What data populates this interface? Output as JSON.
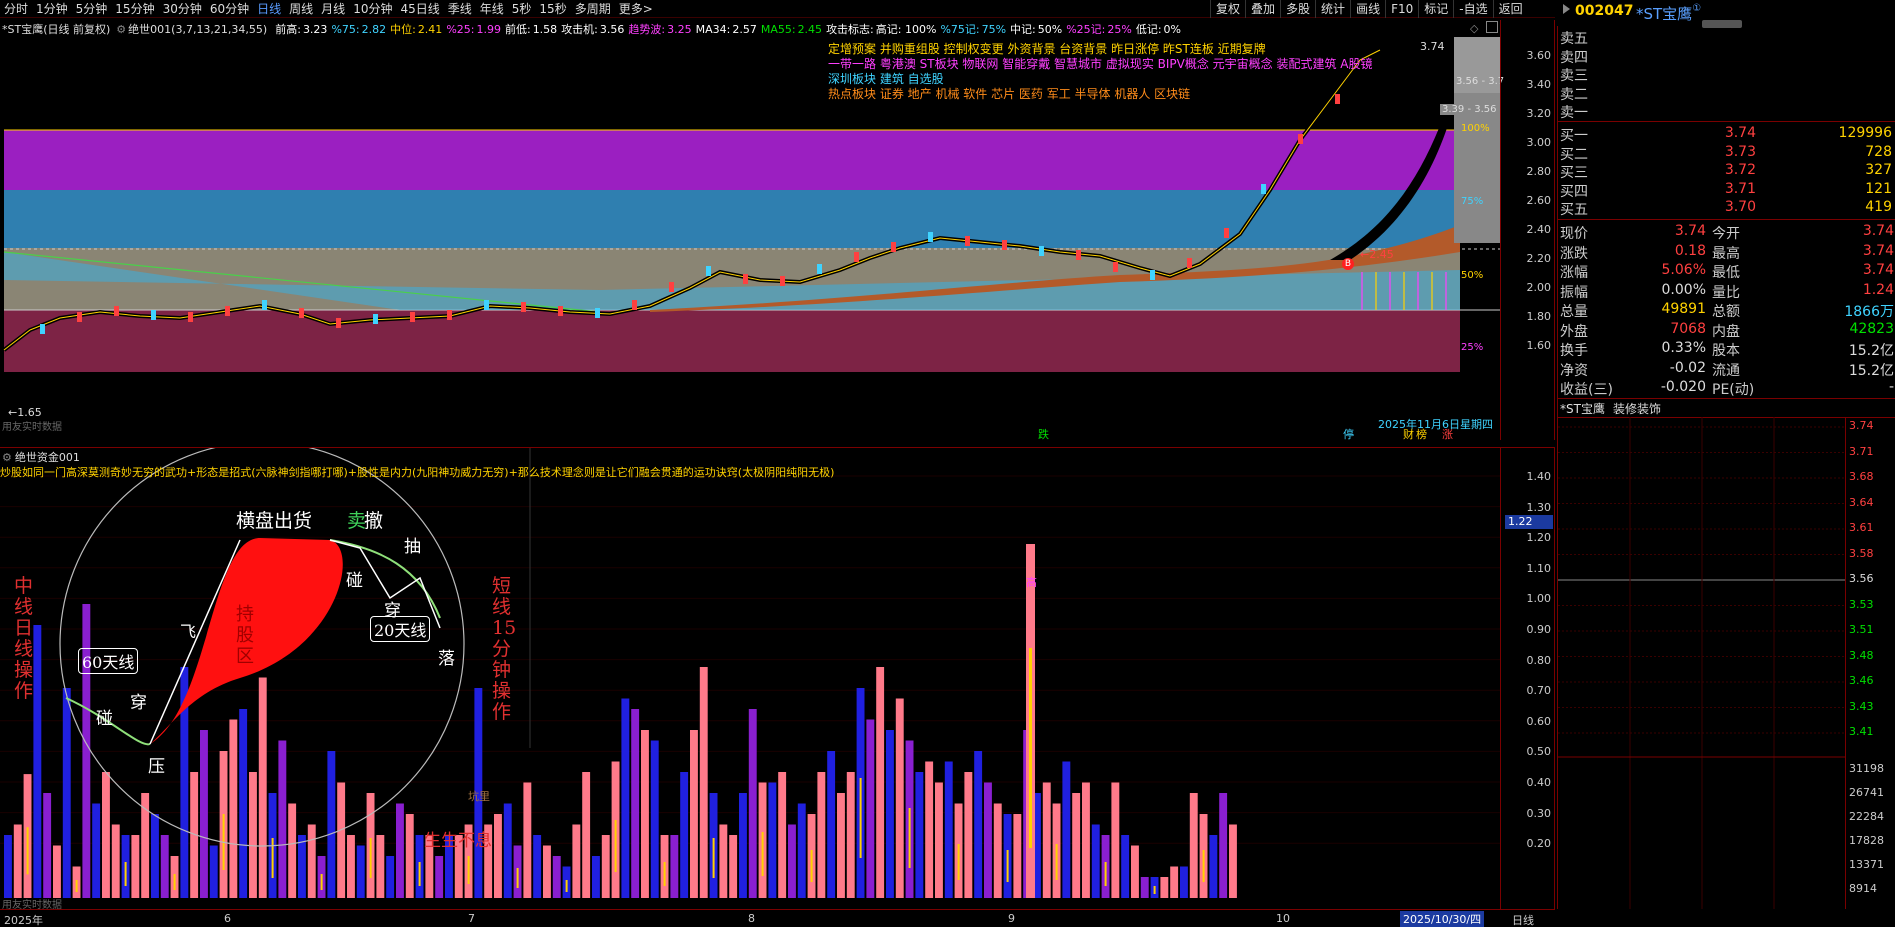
{
  "toolbar": {
    "periods": [
      "分时",
      "1分钟",
      "5分钟",
      "15分钟",
      "30分钟",
      "60分钟",
      "日线",
      "周线",
      "月线",
      "10分钟",
      "45日线",
      "季线",
      "年线",
      "5秒",
      "15秒",
      "多周期",
      "更多>"
    ],
    "active_period": "日线",
    "right_buttons": [
      "复权",
      "叠加",
      "多股",
      "统计",
      "画线",
      "F10",
      "标记",
      "-自选",
      "返回"
    ]
  },
  "stock": {
    "code": "002047",
    "name": "*ST宝鹰",
    "badge": "①"
  },
  "main_chart": {
    "title": "*ST宝鹰(日线 前复权)",
    "indicator_name": "绝世001",
    "indicator_params": "(3,7,13,21,34,55)",
    "readouts": [
      {
        "label": "前高:",
        "value": "3.23",
        "color": "#ffffff"
      },
      {
        "label": "%75:",
        "value": "2.82",
        "color": "#3fd3ff"
      },
      {
        "label": "中位:",
        "value": "2.41",
        "color": "#ffd200"
      },
      {
        "label": "%25:",
        "value": "1.99",
        "color": "#ff40ff"
      },
      {
        "label": "前低:",
        "value": "1.58",
        "color": "#ffffff"
      },
      {
        "label": "攻击机:",
        "value": "3.56",
        "color": "#ffffff"
      },
      {
        "label": "趋势波:",
        "value": "3.25",
        "color": "#ff40ff"
      },
      {
        "label": "MA34:",
        "value": "2.57",
        "color": "#ffffff"
      },
      {
        "label": "MA55:",
        "value": "2.45",
        "color": "#00e000"
      },
      {
        "label": "攻击标志:",
        "value": "高记: 100%",
        "color": "#ffffff"
      },
      {
        "label": "%75记:",
        "value": "75%",
        "color": "#3fd3ff"
      },
      {
        "label": "中记:",
        "value": "50%",
        "color": "#ffffff"
      },
      {
        "label": "%25记:",
        "value": "25%",
        "color": "#ff40ff"
      },
      {
        "label": "低记:",
        "value": "0%",
        "color": "#ffffff"
      }
    ],
    "info_lines": [
      {
        "label": "定增预案 并购重组股 控制权变更 外资背景 台资背景 昨日涨停 昨ST连板 近期复牌",
        "color": "#ffd200"
      },
      {
        "label": "一带一路 粤港澳 ST板块 物联网 智能穿戴 智慧城市 虚拟现实 BIPV概念 元宇宙概念 装配式建筑 A股镜",
        "color": "#ff40ff"
      },
      {
        "label": "深圳板块  建筑        自选股",
        "color": "#3fd3ff"
      },
      {
        "label": "热点板块  证券 地产 机械 软件 芯片 医药 军工 半导体 机器人 区块链",
        "color": "#ff8c1a"
      }
    ],
    "y_ticks": [
      "3.60",
      "3.40",
      "3.20",
      "3.00",
      "2.80",
      "2.60",
      "2.40",
      "2.20",
      "2.00",
      "1.80",
      "1.60"
    ],
    "zone_labels": [
      "100%",
      "75%",
      "50%",
      "25%"
    ],
    "low_label": "1.65",
    "last_price_tag": "3.74",
    "price_tag_2": "3.56 - 3.7",
    "price_tag_3": "3.39 - 3.56",
    "signal_b": "B",
    "signal_price": "2.45",
    "date_label": "2025年11月6日星期四",
    "bottom_marks": [
      {
        "text": "跌",
        "color": "#00e000"
      },
      {
        "text": "停",
        "color": "#3fd3ff"
      },
      {
        "text": "财",
        "color": "#ffd200"
      },
      {
        "text": "榜",
        "color": "#ffd200"
      },
      {
        "text": "涨",
        "color": "#ff4040"
      }
    ],
    "source_tag": "用友实时数据"
  },
  "indicator_chart": {
    "title": "绝世资金001",
    "description": "炒股如同一门高深莫测奇妙无穷的武功+形态是招式(六脉神剑指哪打哪)+股性是内力(九阳神功威力无穷)+那么技术理念则是让它们融会贯通的运功诀窍(太极阴阳纯阳无极)",
    "y_ticks": [
      "1.40",
      "1.30",
      "1.20",
      "1.10",
      "1.00",
      "0.90",
      "0.80",
      "0.70",
      "0.60",
      "0.50",
      "0.40",
      "0.30",
      "0.20"
    ],
    "current_value": "1.22",
    "peak_mark": "高",
    "diagram": {
      "top": "横盘出货",
      "sell": "卖",
      "cut": "撤",
      "pull": "抽",
      "touch": "碰",
      "cross": "穿",
      "twenty": "20天线",
      "fall": "落",
      "fly": "飞",
      "hold": "持股区",
      "sixty": "60天线",
      "touch2": "碰",
      "cross2": "穿",
      "press": "压",
      "left_vertical": "中线日线操作",
      "right_vertical": "短线15分钟操作",
      "pit": "坑里",
      "life": "生生不息"
    },
    "source_tag": "用友实时数据"
  },
  "x_axis": {
    "labels": [
      "2025年",
      "6",
      "7",
      "8",
      "9",
      "10"
    ],
    "current_date": "2025/10/30/四",
    "period": "日线"
  },
  "order_book": {
    "asks": [
      {
        "label": "卖五",
        "price": "",
        "vol": ""
      },
      {
        "label": "卖四",
        "price": "",
        "vol": ""
      },
      {
        "label": "卖三",
        "price": "",
        "vol": ""
      },
      {
        "label": "卖二",
        "price": "",
        "vol": ""
      },
      {
        "label": "卖一",
        "price": "",
        "vol": ""
      }
    ],
    "bids": [
      {
        "label": "买一",
        "price": "3.74",
        "vol": "129996"
      },
      {
        "label": "买二",
        "price": "3.73",
        "vol": "728"
      },
      {
        "label": "买三",
        "price": "3.72",
        "vol": "327"
      },
      {
        "label": "买四",
        "price": "3.71",
        "vol": "121"
      },
      {
        "label": "买五",
        "price": "3.70",
        "vol": "419"
      }
    ]
  },
  "quote": [
    {
      "l1": "现价",
      "v1": "3.74",
      "c1": "red",
      "l2": "今开",
      "v2": "3.74",
      "c2": "red"
    },
    {
      "l1": "涨跌",
      "v1": "0.18",
      "c1": "red",
      "l2": "最高",
      "v2": "3.74",
      "c2": "red"
    },
    {
      "l1": "涨幅",
      "v1": "5.06%",
      "c1": "red",
      "l2": "最低",
      "v2": "3.74",
      "c2": "red"
    },
    {
      "l1": "振幅",
      "v1": "0.00%",
      "c1": "white",
      "l2": "量比",
      "v2": "1.24",
      "c2": "red"
    },
    {
      "l1": "总量",
      "v1": "49891",
      "c1": "yellow",
      "l2": "总额",
      "v2": "1866万",
      "c2": "cyan"
    },
    {
      "l1": "外盘",
      "v1": "7068",
      "c1": "red",
      "l2": "内盘",
      "v2": "42823",
      "c2": "green"
    },
    {
      "l1": "换手",
      "v1": "0.33%",
      "c1": "white",
      "l2": "股本",
      "v2": "15.2亿",
      "c2": "white"
    },
    {
      "l1": "净资",
      "v1": "-0.02",
      "c1": "white",
      "l2": "流通",
      "v2": "15.2亿",
      "c2": "white"
    },
    {
      "l1": "收益(三)",
      "v1": "-0.020",
      "c1": "white",
      "l2": "PE(动)",
      "v2": "-",
      "c2": "white"
    }
  ],
  "mini_chart": {
    "title": "*ST宝鹰",
    "sector": "装修装饰",
    "price_ticks": [
      "3.74",
      "3.71",
      "3.68",
      "3.64",
      "3.61",
      "3.58",
      "3.56",
      "3.53",
      "3.51",
      "3.48",
      "3.46",
      "3.43",
      "3.41"
    ],
    "vol_ticks": [
      "31198",
      "26741",
      "22284",
      "17828",
      "13371",
      "8914"
    ]
  }
}
